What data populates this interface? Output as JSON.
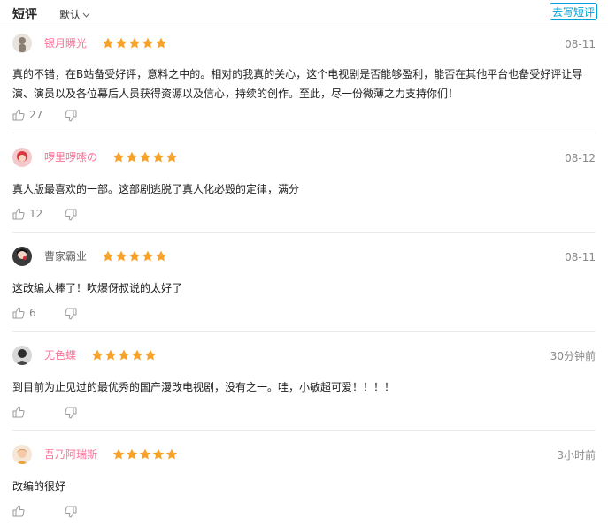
{
  "header": {
    "title": "短评",
    "sort_label": "默认",
    "write_label": "去写短评"
  },
  "colors": {
    "accent": "#00a1d6",
    "pink_name": "#fb7299",
    "gray_name": "#666666",
    "star": "#f7a32a"
  },
  "reviews": [
    {
      "name": "银月瞬光",
      "name_color": "pink",
      "rating": 5,
      "date": "08-11",
      "content": "真的不错，在B站备受好评，意料之中的。相对的我真的关心，这个电视剧是否能够盈利，能否在其他平台也备受好评让导演、演员以及各位幕后人员获得资源以及信心，持续的创作。至此，尽一份微薄之力支持你们！",
      "likes": "27"
    },
    {
      "name": "啰里啰嗦の",
      "name_color": "pink",
      "rating": 5,
      "date": "08-12",
      "content": "真人版最喜欢的一部。这部剧逃脱了真人化必毁的定律，满分",
      "likes": "12"
    },
    {
      "name": "曹家霸业",
      "name_color": "gray",
      "rating": 5,
      "date": "08-11",
      "content": "这改编太棒了！吹爆伢叔说的太好了",
      "likes": "6"
    },
    {
      "name": "无色蝶",
      "name_color": "pink",
      "rating": 5,
      "date": "30分钟前",
      "content": "到目前为止见过的最优秀的国产漫改电视剧，没有之一。哇，小敏超可爱！！！！",
      "likes": ""
    },
    {
      "name": "吾乃阿瑞斯",
      "name_color": "pink",
      "rating": 5,
      "date": "3小时前",
      "content": "改编的很好",
      "likes": ""
    }
  ]
}
